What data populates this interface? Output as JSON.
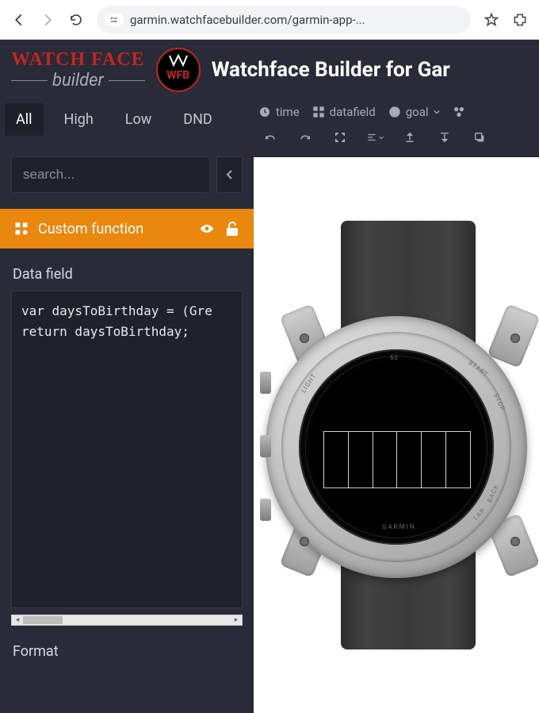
{
  "browser": {
    "url_display": "garmin.watchfacebuilder.com/garmin-app-..."
  },
  "brand": {
    "line1": "WATCH FACE",
    "line2": "builder",
    "badge": "WFB"
  },
  "app_title": "Watchface Builder for Gar",
  "filters": {
    "items": [
      "All",
      "High",
      "Low",
      "DND"
    ],
    "active_index": 0
  },
  "search": {
    "placeholder": "search..."
  },
  "selected_element": {
    "label": "Custom function"
  },
  "section": {
    "data_field_label": "Data field",
    "format_label": "Format"
  },
  "code": "var daysToBirthday = (Gre\nreturn daysToBirthday;",
  "toolbar": {
    "time": "time",
    "datafield": "datafield",
    "goal": "goal"
  },
  "watch": {
    "bezel_labels": {
      "start": "START",
      "stop": "STOP",
      "back": "BACK",
      "lap": "LAP",
      "light": "LIGHT"
    },
    "brand_label": "GARMIN",
    "tick_60": "60",
    "datafield_cells": 6
  }
}
